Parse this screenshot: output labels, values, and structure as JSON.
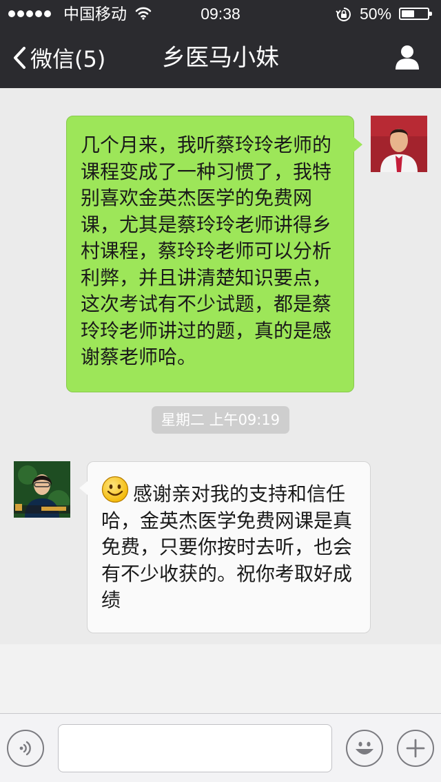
{
  "status_bar": {
    "carrier": "中国移动",
    "time": "09:38",
    "battery_percent": "50%",
    "battery_level": 0.5,
    "signal_bars": 5
  },
  "nav": {
    "back_label": "微信(5)",
    "title": "乡医马小妹",
    "icons": {
      "back": "chevron-left-icon",
      "profile": "person-icon"
    }
  },
  "messages": [
    {
      "direction": "outgoing",
      "lines": [
        "几个月来，我听蔡玲玲老师的",
        "课程变成了一种习惯了，我特",
        "别喜欢金英杰医学的免费网",
        "课，尤其是蔡玲玲老师讲得乡",
        "村课程，蔡玲玲老师可以分析",
        "利弊，并且讲清楚知识要点，",
        "这次考试有不少试题，都是蔡",
        "玲玲老师讲过的题，真的是感",
        "谢蔡老师哈。"
      ]
    },
    {
      "direction": "incoming",
      "emoji": "smiley-emoji",
      "lines": [
        "感谢亲对我的支持和信任",
        "哈，金英杰医学免费网课是真",
        "免费，只要你按时去听，也会",
        "有不少收获的。祝你考取好成",
        "绩"
      ]
    }
  ],
  "timestamp": "星期二 上午09:19",
  "input_bar": {
    "text_value": "",
    "icons": [
      "voice-icon",
      "emoji-icon",
      "plus-icon"
    ]
  },
  "colors": {
    "bar_background": "#2b2b2f",
    "chat_background": "#ebebeb",
    "outgoing_bubble": "#9de659",
    "incoming_bubble": "#fafafa"
  }
}
